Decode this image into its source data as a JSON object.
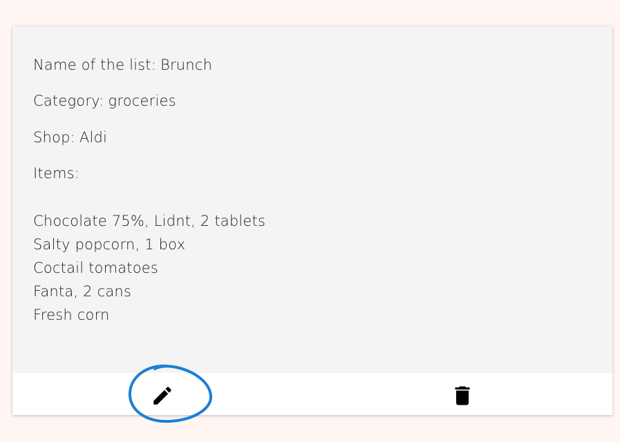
{
  "list": {
    "name_label": "Name of the list:",
    "name_value": "Brunch",
    "category_label": "Category:",
    "category_value": "groceries",
    "shop_label": "Shop:",
    "shop_value": "Aldi",
    "items_label": "Items:",
    "items": [
      "Chocolate 75%, Lidnt, 2 tablets",
      "Salty popcorn, 1 box",
      "Coctail tomatoes",
      "Fanta, 2 cans",
      "Fresh corn"
    ]
  },
  "actions": {
    "edit_icon": "pencil-icon",
    "delete_icon": "trash-icon"
  },
  "colors": {
    "page_background": "#fff5f3",
    "card_background": "#f4f4f4",
    "actions_background": "#ffffff",
    "annotation_circle": "#1a7fd6",
    "icon": "#000000"
  }
}
